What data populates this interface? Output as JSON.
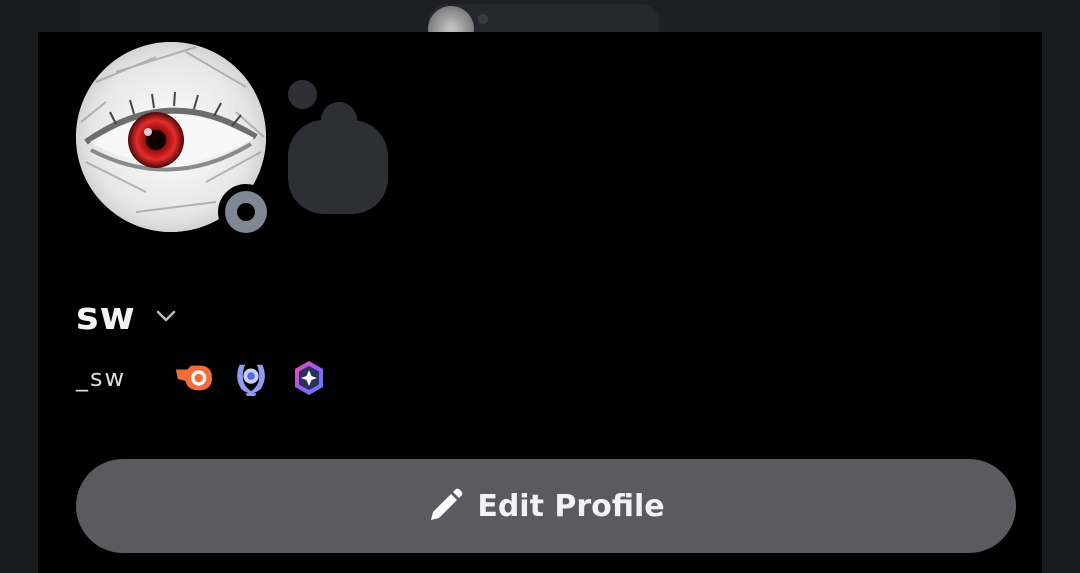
{
  "profile": {
    "display_name": "sw",
    "username": "_sw",
    "status": "idle",
    "badges": [
      {
        "icon": "hypesquad-icon",
        "color": "#f06c3a"
      },
      {
        "icon": "laurel-badge-icon",
        "color": "#8e9cf2"
      },
      {
        "icon": "quest-badge-icon",
        "color": "#9b59f6"
      }
    ]
  },
  "actions": {
    "edit_profile_label": "Edit Profile"
  },
  "colors": {
    "panel_bg": "#000000",
    "button_bg": "#5b5b5f",
    "status_ring": "#808794",
    "eye_iris": "#d42a2a"
  }
}
